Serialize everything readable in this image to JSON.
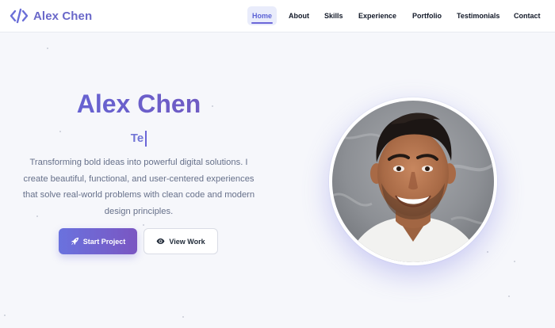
{
  "brand": {
    "name": "Alex Chen",
    "icon": "code-icon",
    "color": "#6a68c9"
  },
  "nav": {
    "items": [
      {
        "label": "Home",
        "active": true
      },
      {
        "label": "About",
        "active": false
      },
      {
        "label": "Skills",
        "active": false
      },
      {
        "label": "Experience",
        "active": false
      },
      {
        "label": "Portfolio",
        "active": false
      },
      {
        "label": "Testimonials",
        "active": false
      },
      {
        "label": "Contact",
        "active": false
      }
    ]
  },
  "hero": {
    "name": "Alex Chen",
    "typed_text": "Te",
    "description": "Transforming bold ideas into powerful digital solutions. I create beautiful, functional, and user-centered experiences that solve real-world problems with clean code and modern design principles.",
    "primary_button": {
      "label": "Start Project",
      "icon": "rocket-icon"
    },
    "secondary_button": {
      "label": "View Work",
      "icon": "eye-icon"
    }
  },
  "portrait": {
    "subject": "smiling man with dark hair in white t-shirt"
  },
  "colors": {
    "accent": "#6b66d8",
    "accent_gradient_start": "#6a72de",
    "accent_gradient_end": "#7a56c2",
    "background": "#f6f7fb",
    "text_muted": "#66708a"
  }
}
